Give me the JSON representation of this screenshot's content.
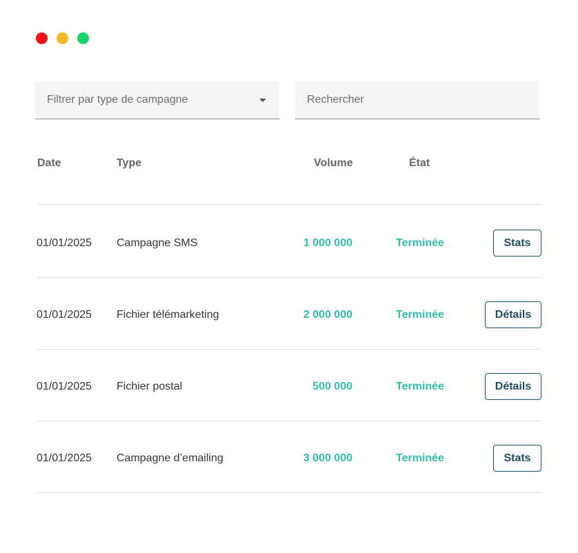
{
  "window": {
    "controls": [
      {
        "name": "close",
        "color": "#f01414"
      },
      {
        "name": "minimize",
        "color": "#f7b924"
      },
      {
        "name": "maximize",
        "color": "#19d265"
      }
    ]
  },
  "filters": {
    "type_filter_label": "Filtrer par type de campagne",
    "search_placeholder": "Rechercher"
  },
  "table": {
    "headers": {
      "date": "Date",
      "type": "Type",
      "volume": "Volume",
      "state": "État"
    },
    "rows": [
      {
        "date": "01/01/2025",
        "type": "Campagne SMS",
        "volume": "1 000 000",
        "state": "Terminée",
        "action": "Stats"
      },
      {
        "date": "01/01/2025",
        "type": "Fichier télémarketing",
        "volume": "2 000 000",
        "state": "Terminée",
        "action": "Détails"
      },
      {
        "date": "01/01/2025",
        "type": "Fichier postal",
        "volume": "500 000",
        "state": "Terminée",
        "action": "Détails"
      },
      {
        "date": "01/01/2025",
        "type": "Campagne d’emailing",
        "volume": "3 000 000",
        "state": "Terminée",
        "action": "Stats"
      }
    ]
  },
  "colors": {
    "accent": "#2ebfae",
    "button_border": "#1f4e63"
  }
}
